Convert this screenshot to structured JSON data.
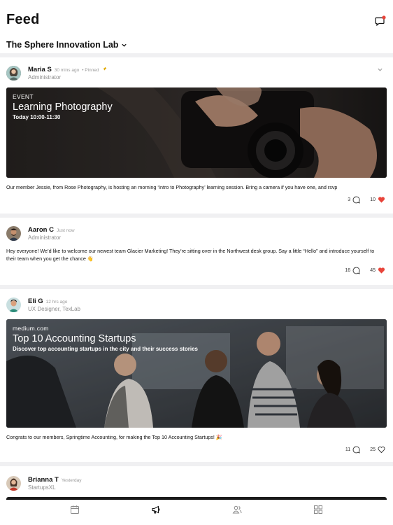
{
  "header": {
    "title": "Feed",
    "community_name": "The Sphere Innovation Lab"
  },
  "icons": {
    "messages": "chat-bubble-icon",
    "dropdown": "chevron-down-icon",
    "comment": "comment-bubble-icon",
    "like": "heart-icon",
    "pin": "pin-icon"
  },
  "colors": {
    "accent_red": "#e8443a",
    "pin_yellow": "#e0a800",
    "separator": "#f0f0f2"
  },
  "posts": [
    {
      "author": "Maria S",
      "time": "30 mins ago",
      "pinned_label": "• Pinned",
      "role": "Administrator",
      "media": {
        "kicker": "EVENT",
        "title": "Learning Photography",
        "subtitle": "Today 10:00-11:30"
      },
      "text": "Our member Jessie, from Rose Photography, is hosting an morning ‘Intro to Photography’ learning session. Bring a camera if you have one, and rsvp",
      "comments": "3",
      "likes": "10",
      "liked": true
    },
    {
      "author": "Aaron C",
      "time": "Just now",
      "role": "Administrator",
      "text": "Hey everyone! We’d like to welcome our newest team Glacier Marketing! They’re sitting over in the Northwest desk group. Say a little “Hello” and introduce yourself to their team when you get the chance 👋",
      "comments": "16",
      "likes": "45",
      "liked": true
    },
    {
      "author": "Eli G",
      "time": "12 hrs ago",
      "role": "UX Designer, TexLab",
      "media": {
        "kicker": "medium.com",
        "title": "Top 10 Accounting Startups",
        "subtitle": "Discover top accounting startups in the city and their success stories"
      },
      "text": "Congrats to our members, Springtime Accounting, for making the Top 10 Accounting Startups! 🎉",
      "comments": "11",
      "likes": "25",
      "liked": false
    },
    {
      "author": "Brianna T",
      "time": "Yesterday",
      "role": "StartupsXL"
    }
  ],
  "tabbar": {
    "tabs": [
      "calendar-icon",
      "megaphone-icon",
      "people-icon",
      "grid-icon"
    ],
    "active": "megaphone-icon"
  }
}
